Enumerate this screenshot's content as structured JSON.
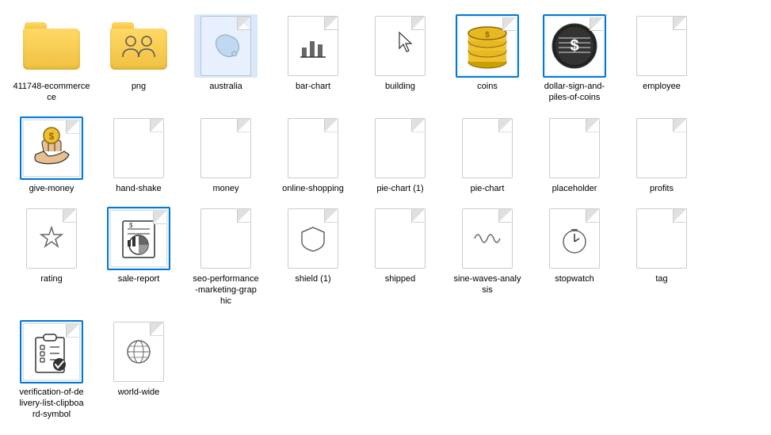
{
  "items": [
    {
      "id": "411748-ecommerce",
      "label": "411748-ecommerce\nce",
      "type": "folder",
      "selected": false
    },
    {
      "id": "png",
      "label": "png",
      "type": "folder",
      "selected": false
    },
    {
      "id": "australia",
      "label": "australia",
      "type": "file-image",
      "selected": false
    },
    {
      "id": "bar-chart",
      "label": "bar-chart",
      "type": "file",
      "selected": false
    },
    {
      "id": "building",
      "label": "building",
      "type": "file-cursor",
      "selected": false
    },
    {
      "id": "coins",
      "label": "coins",
      "type": "file-icon-img",
      "selected": true,
      "iconColor": "#c8a000"
    },
    {
      "id": "dollar-sign-and-piles-of-coins",
      "label": "dollar-sign-and-\npiles-of-coins",
      "type": "file-icon-img",
      "selected": true,
      "iconColor": "#333"
    },
    {
      "id": "employee",
      "label": "employee",
      "type": "file",
      "selected": false
    },
    {
      "id": "give-money",
      "label": "give-money",
      "type": "file-icon-img",
      "selected": true,
      "iconColor": "#333"
    },
    {
      "id": "hand-shake",
      "label": "hand-shake",
      "type": "file",
      "selected": false
    },
    {
      "id": "money",
      "label": "money",
      "type": "file",
      "selected": false
    },
    {
      "id": "online-shopping",
      "label": "online-shopping",
      "type": "file",
      "selected": false
    },
    {
      "id": "pie-chart-1",
      "label": "pie-chart (1)",
      "type": "file",
      "selected": false
    },
    {
      "id": "pie-chart",
      "label": "pie-chart",
      "type": "file",
      "selected": false
    },
    {
      "id": "placeholder",
      "label": "placeholder",
      "type": "file",
      "selected": false
    },
    {
      "id": "profits",
      "label": "profits",
      "type": "file",
      "selected": false
    },
    {
      "id": "rating",
      "label": "rating",
      "type": "file",
      "selected": false
    },
    {
      "id": "sale-report",
      "label": "sale-report",
      "type": "file-icon-img",
      "selected": true,
      "iconColor": "#333"
    },
    {
      "id": "seo-performance",
      "label": "seo-performance\n-marketing-grap\nhic",
      "type": "file",
      "selected": false
    },
    {
      "id": "shield-1",
      "label": "shield (1)",
      "type": "file",
      "selected": false
    },
    {
      "id": "shipped",
      "label": "shipped",
      "type": "file",
      "selected": false
    },
    {
      "id": "sine-waves-analysis",
      "label": "sine-waves-analy\nsis",
      "type": "file",
      "selected": false
    },
    {
      "id": "stopwatch",
      "label": "stopwatch",
      "type": "file",
      "selected": false
    },
    {
      "id": "tag",
      "label": "tag",
      "type": "file",
      "selected": false
    },
    {
      "id": "verification-of-delivery",
      "label": "verification-of-de\nlivery-list-clipboa\nrd-symbol",
      "type": "file-icon-img",
      "selected": true,
      "iconColor": "#333"
    },
    {
      "id": "world-wide",
      "label": "world-wide",
      "type": "file",
      "selected": false
    }
  ]
}
